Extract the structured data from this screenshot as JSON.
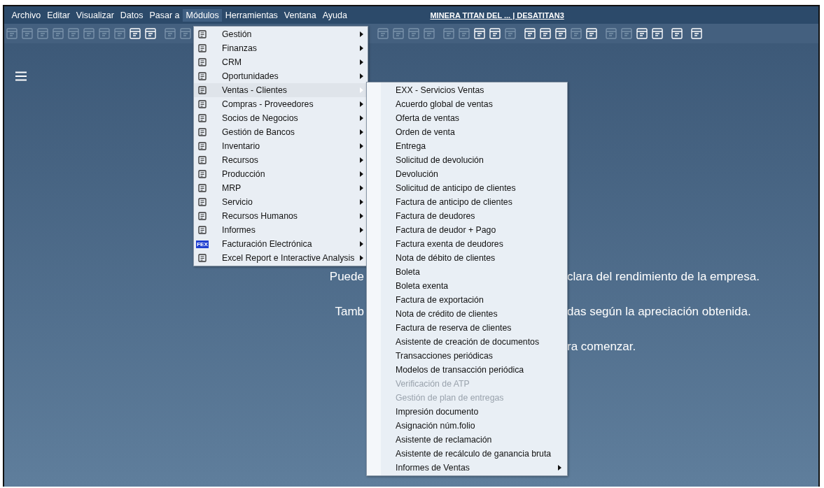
{
  "menubar": [
    {
      "label": "Archivo",
      "selected": false
    },
    {
      "label": "Editar",
      "selected": false
    },
    {
      "label": "Visualizar",
      "selected": false
    },
    {
      "label": "Datos",
      "selected": false
    },
    {
      "label": "Pasar a",
      "selected": false
    },
    {
      "label": "Módulos",
      "selected": true
    },
    {
      "label": "Herramientas",
      "selected": false
    },
    {
      "label": "Ventana",
      "selected": false
    },
    {
      "label": "Ayuda",
      "selected": false
    }
  ],
  "company_title": "MINERA TITAN DEL ... | DESATITAN3",
  "toolbar": {
    "left": [
      [
        {
          "disabled": true
        },
        {
          "disabled": true
        },
        {
          "disabled": true
        },
        {
          "disabled": true
        },
        {
          "disabled": true
        },
        {
          "disabled": true
        },
        {
          "disabled": true
        },
        {
          "disabled": true
        },
        {
          "disabled": false
        },
        {
          "disabled": false
        }
      ],
      [
        {
          "disabled": true
        },
        {
          "disabled": true
        }
      ]
    ],
    "right": [
      [
        {
          "disabled": true
        },
        {
          "disabled": true
        },
        {
          "disabled": true
        },
        {
          "disabled": true
        }
      ],
      [
        {
          "disabled": true
        },
        {
          "disabled": true
        },
        {
          "disabled": false
        },
        {
          "disabled": false
        },
        {
          "disabled": true
        }
      ],
      [
        {
          "disabled": false
        },
        {
          "disabled": false
        },
        {
          "disabled": false
        },
        {
          "disabled": true
        },
        {
          "disabled": false
        }
      ],
      [
        {
          "disabled": true
        },
        {
          "disabled": true
        },
        {
          "disabled": false
        },
        {
          "disabled": false
        }
      ],
      [
        {
          "disabled": false
        }
      ],
      [
        {
          "disabled": false
        }
      ]
    ]
  },
  "background_lines": [
    {
      "left": "Puede",
      "right": "clara del rendimiento de la empresa."
    },
    {
      "left": "Tamb",
      "right": "das según la apreciación obtenida."
    },
    {
      "right": "ra comenzar."
    }
  ],
  "modules_menu": [
    {
      "label": "Gestión",
      "selected": false,
      "kind": "icon"
    },
    {
      "label": "Finanzas",
      "selected": false,
      "kind": "icon"
    },
    {
      "label": "CRM",
      "selected": false,
      "kind": "icon"
    },
    {
      "label": "Oportunidades",
      "selected": false,
      "kind": "icon"
    },
    {
      "label": "Ventas - Clientes",
      "selected": true,
      "kind": "icon"
    },
    {
      "label": "Compras - Proveedores",
      "selected": false,
      "kind": "icon"
    },
    {
      "label": "Socios de Negocios",
      "selected": false,
      "kind": "icon"
    },
    {
      "label": "Gestión de Bancos",
      "selected": false,
      "kind": "icon"
    },
    {
      "label": "Inventario",
      "selected": false,
      "kind": "icon"
    },
    {
      "label": "Recursos",
      "selected": false,
      "kind": "icon"
    },
    {
      "label": "Producción",
      "selected": false,
      "kind": "icon"
    },
    {
      "label": "MRP",
      "selected": false,
      "kind": "icon"
    },
    {
      "label": "Servicio",
      "selected": false,
      "kind": "icon"
    },
    {
      "label": "Recursos Humanos",
      "selected": false,
      "kind": "icon"
    },
    {
      "label": "Informes",
      "selected": false,
      "kind": "icon"
    },
    {
      "label": "Facturación Electrónica",
      "selected": false,
      "kind": "badge",
      "badge": "FEX"
    },
    {
      "label": "Excel Report e Interactive Analysis",
      "selected": false,
      "kind": "icon"
    }
  ],
  "sales_submenu": [
    {
      "label": "EXX - Servicios Ventas",
      "disabled": false,
      "submenu": false
    },
    {
      "label": "Acuerdo global de ventas",
      "disabled": false,
      "submenu": false
    },
    {
      "label": "Oferta de ventas",
      "disabled": false,
      "submenu": false
    },
    {
      "label": "Orden de venta",
      "disabled": false,
      "submenu": false
    },
    {
      "label": "Entrega",
      "disabled": false,
      "submenu": false
    },
    {
      "label": "Solicitud de devolución",
      "disabled": false,
      "submenu": false
    },
    {
      "label": "Devolución",
      "disabled": false,
      "submenu": false
    },
    {
      "label": "Solicitud de anticipo de clientes",
      "disabled": false,
      "submenu": false
    },
    {
      "label": "Factura de anticipo de clientes",
      "disabled": false,
      "submenu": false
    },
    {
      "label": "Factura de deudores",
      "disabled": false,
      "submenu": false
    },
    {
      "label": "Factura de deudor + Pago",
      "disabled": false,
      "submenu": false
    },
    {
      "label": "Factura exenta de deudores",
      "disabled": false,
      "submenu": false
    },
    {
      "label": "Nota de débito de clientes",
      "disabled": false,
      "submenu": false
    },
    {
      "label": "Boleta",
      "disabled": false,
      "submenu": false
    },
    {
      "label": "Boleta exenta",
      "disabled": false,
      "submenu": false
    },
    {
      "label": "Factura de exportación",
      "disabled": false,
      "submenu": false
    },
    {
      "label": "Nota de crédito de clientes",
      "disabled": false,
      "submenu": false
    },
    {
      "label": "Factura de reserva de clientes",
      "disabled": false,
      "submenu": false
    },
    {
      "label": "Asistente de creación de documentos",
      "disabled": false,
      "submenu": false
    },
    {
      "label": "Transacciones periódicas",
      "disabled": false,
      "submenu": false
    },
    {
      "label": "Modelos de transacción periódica",
      "disabled": false,
      "submenu": false
    },
    {
      "label": "Verificación de ATP",
      "disabled": true,
      "submenu": false
    },
    {
      "label": "Gestión de plan de entregas",
      "disabled": true,
      "submenu": false
    },
    {
      "label": "Impresión documento",
      "disabled": false,
      "submenu": false
    },
    {
      "label": "Asignación núm.folio",
      "disabled": false,
      "submenu": false
    },
    {
      "label": "Asistente de reclamación",
      "disabled": false,
      "submenu": false
    },
    {
      "label": "Asistente de recálculo de ganancia bruta",
      "disabled": false,
      "submenu": false
    },
    {
      "label": "Informes de Ventas",
      "disabled": false,
      "submenu": true
    }
  ]
}
